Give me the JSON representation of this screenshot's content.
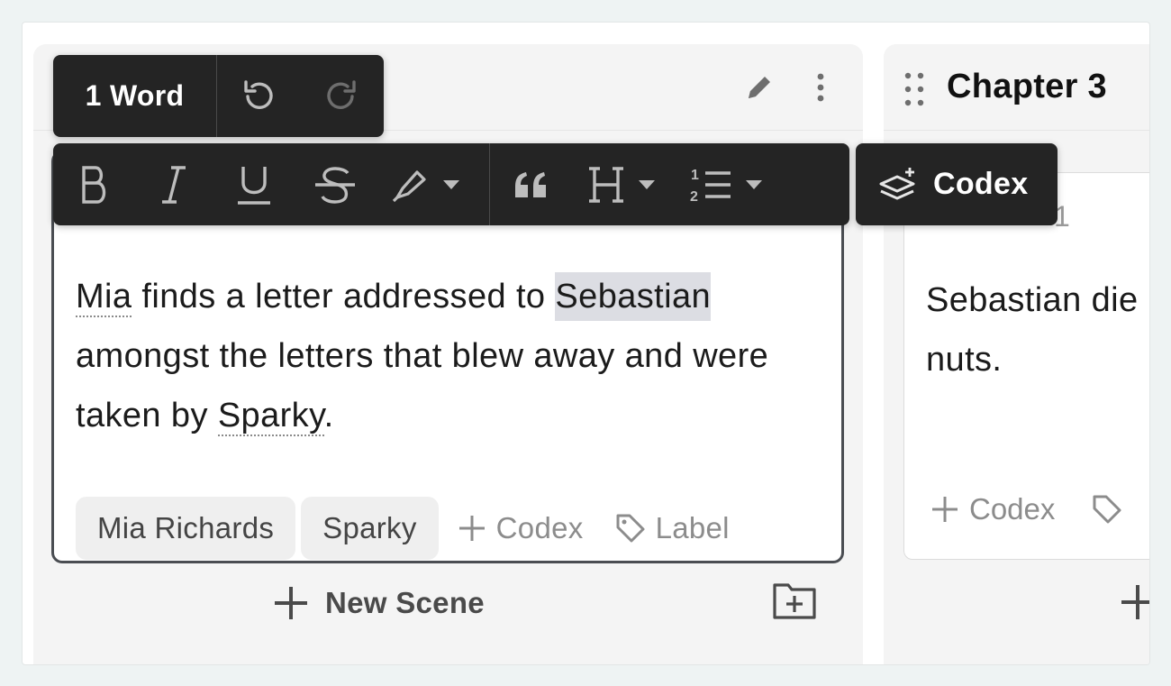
{
  "toolbar_top": {
    "word_count": "1 Word"
  },
  "format_toolbar": {
    "buttons": [
      "bold",
      "italic",
      "underline",
      "strikethrough",
      "highlight",
      "quote",
      "heading",
      "ordered-list"
    ]
  },
  "codex_popover": {
    "label": "Codex"
  },
  "column1": {
    "scene": {
      "text_before": "Mia",
      "text_mid": " finds a letter addressed to ",
      "text_selected": "Sebastian",
      "text_line2": " amongst the letters that blew away and were taken by ",
      "text_ref2": "Sparky",
      "text_end": "."
    },
    "tags": [
      "Mia Richards",
      "Sparky"
    ],
    "add_codex": "Codex",
    "add_label": "Label",
    "new_scene": "New Scene"
  },
  "column2": {
    "title": "Chapter 3",
    "scene_number_partial": "1",
    "scene_text_line1": "Sebastian die",
    "scene_text_line2": "nuts.",
    "add_codex": "Codex"
  },
  "colors": {
    "toolbar_bg": "#242424",
    "selection": "#dcdde3",
    "card_border": "#4a4d52"
  }
}
